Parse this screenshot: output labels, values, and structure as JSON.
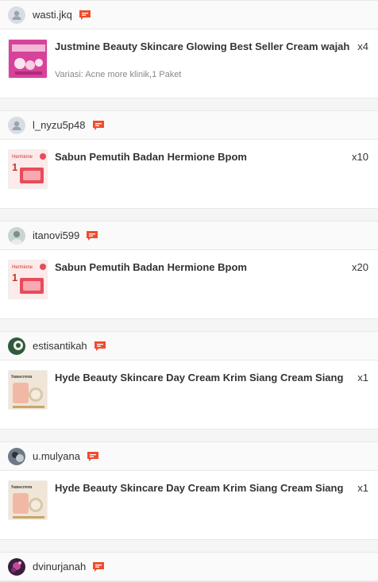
{
  "colors": {
    "accent": "#ee4d2d",
    "divider": "#e8e8e8",
    "background": "#f5f5f5"
  },
  "orders": [
    {
      "username": "wasti.jkq",
      "avatar": "default-user-icon",
      "product": "Justmine Beauty Skincare Glowing Best Seller Cream wajah",
      "variation": "Variasi: Acne more klinik,1 Paket",
      "qty": "x4",
      "thumb": "justmine-product-thumbnail"
    },
    {
      "username": "l_nyzu5p48",
      "avatar": "default-user-icon",
      "product": "Sabun Pemutih Badan Hermione Bpom",
      "variation": "",
      "qty": "x10",
      "thumb": "hermione-soap-thumbnail"
    },
    {
      "username": "itanovi599",
      "avatar": "photo-avatar",
      "product": "Sabun Pemutih Badan Hermione Bpom",
      "variation": "",
      "qty": "x20",
      "thumb": "hermione-soap-thumbnail"
    },
    {
      "username": "estisantikah",
      "avatar": "photo-avatar",
      "product": "Hyde Beauty Skincare Day Cream Krim Siang Cream Siang",
      "variation": "",
      "qty": "x1",
      "thumb": "hyde-cream-thumbnail"
    },
    {
      "username": "u.mulyana",
      "avatar": "photo-avatar",
      "product": "Hyde Beauty Skincare Day Cream Krim Siang Cream Siang",
      "variation": "",
      "qty": "x1",
      "thumb": "hyde-cream-thumbnail"
    },
    {
      "username": "dvinurjanah",
      "avatar": "photo-avatar",
      "product": "",
      "variation": "",
      "qty": "",
      "thumb": ""
    }
  ]
}
